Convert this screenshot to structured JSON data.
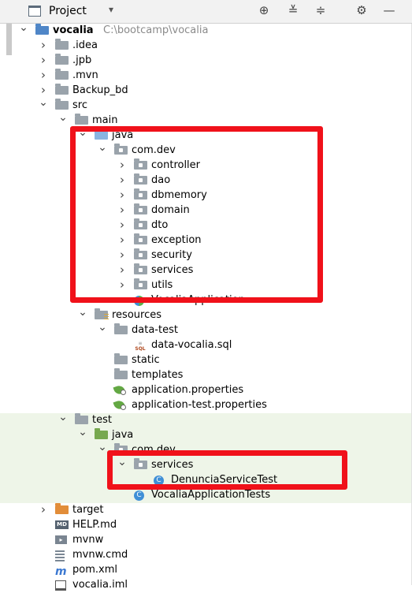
{
  "toolbar": {
    "title": "Project",
    "caret": "▾",
    "icons": [
      "crosshair-icon",
      "expand-all-icon",
      "collapse-all-icon",
      "gear-icon",
      "minimize-icon"
    ]
  },
  "tree": [
    {
      "id": "vocalia",
      "label": "vocalia",
      "path": "C:\\bootcamp\\vocalia",
      "depth": 0,
      "expanded": true,
      "icon": "module-folder-icon"
    },
    {
      "id": "idea",
      "label": ".idea",
      "depth": 1,
      "expanded": false,
      "icon": "folder-icon"
    },
    {
      "id": "jpb",
      "label": ".jpb",
      "depth": 1,
      "expanded": false,
      "icon": "folder-icon"
    },
    {
      "id": "mvn",
      "label": ".mvn",
      "depth": 1,
      "expanded": false,
      "icon": "folder-icon"
    },
    {
      "id": "backup-bd",
      "label": "Backup_bd",
      "depth": 1,
      "expanded": false,
      "icon": "folder-icon"
    },
    {
      "id": "src",
      "label": "src",
      "depth": 1,
      "expanded": true,
      "icon": "folder-icon"
    },
    {
      "id": "main",
      "label": "main",
      "depth": 2,
      "expanded": true,
      "icon": "folder-icon"
    },
    {
      "id": "java-main",
      "label": "java",
      "depth": 3,
      "expanded": true,
      "icon": "source-folder-icon"
    },
    {
      "id": "com-dev-main",
      "label": "com.dev",
      "depth": 4,
      "expanded": true,
      "icon": "package-icon"
    },
    {
      "id": "controller",
      "label": "controller",
      "depth": 5,
      "expanded": false,
      "icon": "package-icon"
    },
    {
      "id": "dao",
      "label": "dao",
      "depth": 5,
      "expanded": false,
      "icon": "package-icon"
    },
    {
      "id": "dbmemory",
      "label": "dbmemory",
      "depth": 5,
      "expanded": false,
      "icon": "package-icon"
    },
    {
      "id": "domain",
      "label": "domain",
      "depth": 5,
      "expanded": false,
      "icon": "package-icon"
    },
    {
      "id": "dto",
      "label": "dto",
      "depth": 5,
      "expanded": false,
      "icon": "package-icon"
    },
    {
      "id": "exception",
      "label": "exception",
      "depth": 5,
      "expanded": false,
      "icon": "package-icon"
    },
    {
      "id": "security",
      "label": "security",
      "depth": 5,
      "expanded": false,
      "icon": "package-icon"
    },
    {
      "id": "services-main",
      "label": "services",
      "depth": 5,
      "expanded": false,
      "icon": "package-icon"
    },
    {
      "id": "utils",
      "label": "utils",
      "depth": 5,
      "expanded": false,
      "icon": "package-icon"
    },
    {
      "id": "vocalia-app",
      "label": "VocaliaApplication",
      "depth": 5,
      "icon": "spring-class-icon"
    },
    {
      "id": "resources",
      "label": "resources",
      "depth": 3,
      "expanded": true,
      "icon": "resources-folder-icon"
    },
    {
      "id": "data-test",
      "label": "data-test",
      "depth": 4,
      "expanded": true,
      "icon": "folder-icon"
    },
    {
      "id": "data-vocalia-sql",
      "label": "data-vocalia.sql",
      "depth": 5,
      "icon": "sql-file-icon"
    },
    {
      "id": "static",
      "label": "static",
      "depth": 4,
      "icon": "folder-icon"
    },
    {
      "id": "templates",
      "label": "templates",
      "depth": 4,
      "icon": "folder-icon"
    },
    {
      "id": "app-props",
      "label": "application.properties",
      "depth": 4,
      "icon": "spring-properties-icon"
    },
    {
      "id": "app-test-props",
      "label": "application-test.properties",
      "depth": 4,
      "icon": "spring-properties-icon"
    },
    {
      "id": "test",
      "label": "test",
      "depth": 2,
      "expanded": true,
      "icon": "folder-icon",
      "tint": true
    },
    {
      "id": "java-test",
      "label": "java",
      "depth": 3,
      "expanded": true,
      "icon": "test-folder-icon",
      "tint": true
    },
    {
      "id": "com-dev-test",
      "label": "com.dev",
      "depth": 4,
      "expanded": true,
      "icon": "package-icon",
      "tint": true
    },
    {
      "id": "services-test",
      "label": "services",
      "depth": 5,
      "expanded": true,
      "icon": "package-icon",
      "tint": true
    },
    {
      "id": "denuncia-test",
      "label": "DenunciaServiceTest",
      "depth": 6,
      "icon": "class-icon",
      "tint": true
    },
    {
      "id": "vocalia-app-tests",
      "label": "VocaliaApplicationTests",
      "depth": 5,
      "icon": "class-icon",
      "tint": true
    },
    {
      "id": "target",
      "label": "target",
      "depth": 1,
      "expanded": false,
      "icon": "excluded-folder-icon"
    },
    {
      "id": "help-md",
      "label": "HELP.md",
      "depth": 1,
      "icon": "markdown-file-icon"
    },
    {
      "id": "mvnw",
      "label": "mvnw",
      "depth": 1,
      "icon": "shell-script-icon"
    },
    {
      "id": "mvnw-cmd",
      "label": "mvnw.cmd",
      "depth": 1,
      "icon": "text-file-icon"
    },
    {
      "id": "pom-xml",
      "label": "pom.xml",
      "depth": 1,
      "icon": "maven-icon"
    },
    {
      "id": "vocalia-iml",
      "label": "vocalia.iml",
      "depth": 1,
      "icon": "iml-file-icon"
    }
  ],
  "annotations": [
    {
      "id": "highlight-java-main",
      "color": "#f0111a"
    },
    {
      "id": "highlight-services-test",
      "color": "#f0111a"
    }
  ]
}
